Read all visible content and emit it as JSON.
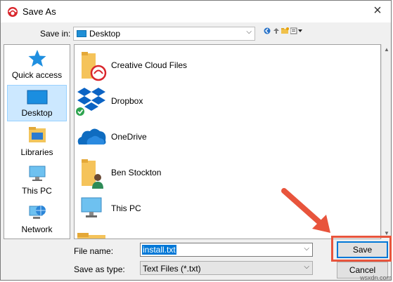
{
  "window": {
    "title": "Save As"
  },
  "savein": {
    "label": "Save in:",
    "location": "Desktop"
  },
  "places": [
    {
      "label": "Quick access",
      "icon": "star-icon"
    },
    {
      "label": "Desktop",
      "icon": "desktop-icon",
      "selected": true
    },
    {
      "label": "Libraries",
      "icon": "libraries-icon"
    },
    {
      "label": "This PC",
      "icon": "computer-icon"
    },
    {
      "label": "Network",
      "icon": "network-icon"
    }
  ],
  "files": [
    {
      "name": "Creative Cloud Files",
      "icon": "creative-cloud-folder-icon"
    },
    {
      "name": "Dropbox",
      "icon": "dropbox-icon"
    },
    {
      "name": "OneDrive",
      "icon": "onedrive-icon"
    },
    {
      "name": "Ben Stockton",
      "icon": "user-folder-icon"
    },
    {
      "name": "This PC",
      "icon": "computer-icon"
    },
    {
      "name": "",
      "icon": "folder-icon"
    }
  ],
  "filename": {
    "label": "File name:",
    "value": "install.txt"
  },
  "savetype": {
    "label": "Save as type:",
    "value": "Text Files (*.txt)"
  },
  "buttons": {
    "save": "Save",
    "cancel": "Cancel"
  },
  "watermark": "wsxdn.com",
  "colors": {
    "accent": "#0078d7",
    "highlight": "#e8543c",
    "selection": "#cce8ff"
  }
}
